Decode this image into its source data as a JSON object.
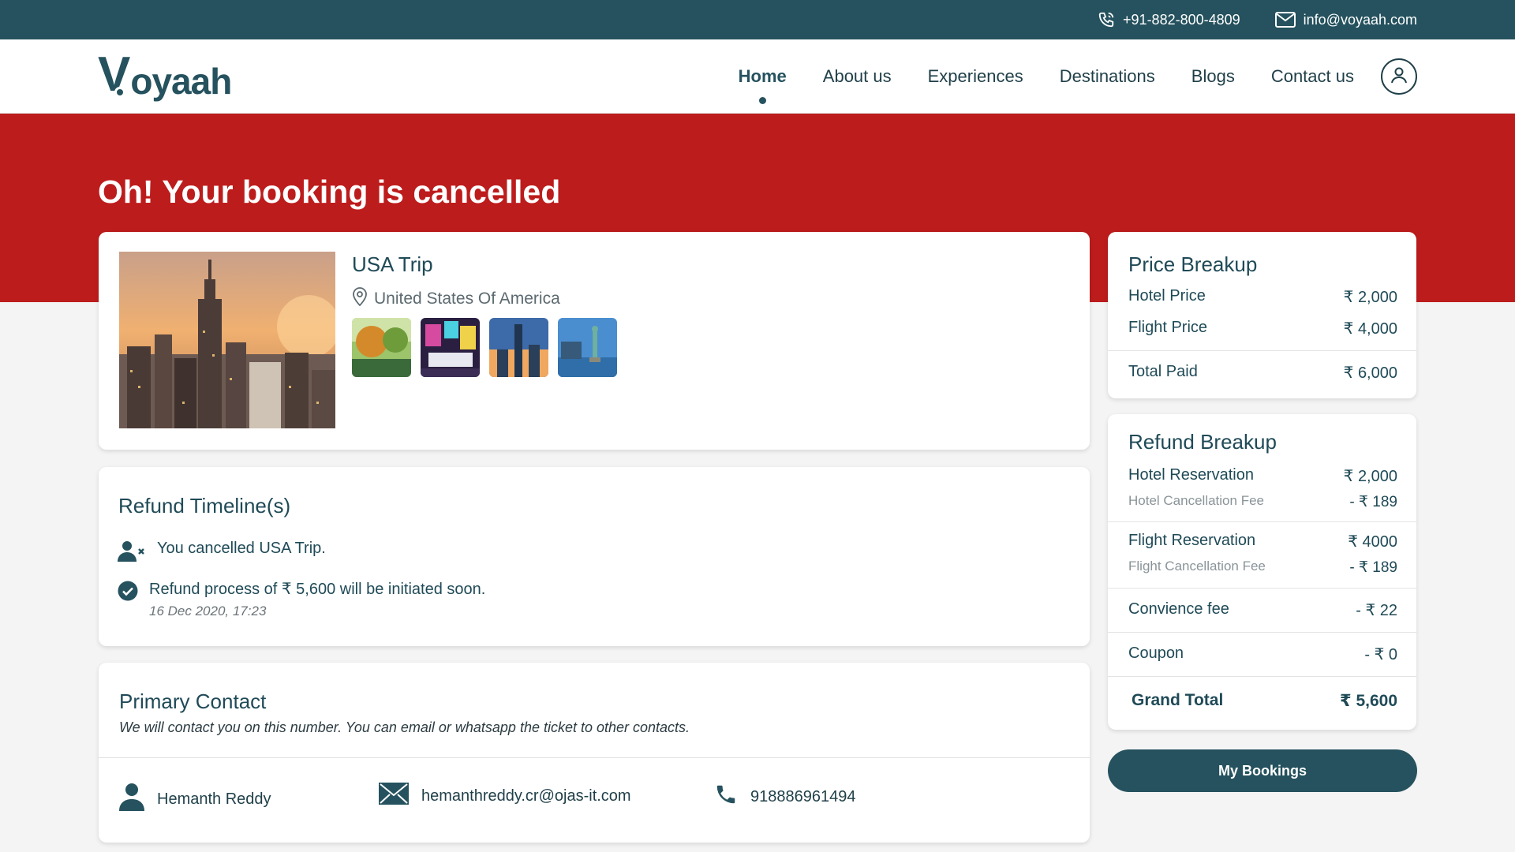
{
  "topbar": {
    "phone": "+91-882-800-4809",
    "email": "info@voyaah.com"
  },
  "brand": {
    "logo_v": "V",
    "logo_rest": "oyaah"
  },
  "nav": {
    "items": [
      {
        "label": "Home",
        "active": true
      },
      {
        "label": "About us"
      },
      {
        "label": "Experiences"
      },
      {
        "label": "Destinations"
      },
      {
        "label": "Blogs"
      },
      {
        "label": "Contact us"
      }
    ],
    "user_icon": "user-icon"
  },
  "banner": {
    "title": "Oh! Your booking is cancelled",
    "color": "#bd1c1c"
  },
  "trip": {
    "title": "USA Trip",
    "location": "United States Of America"
  },
  "timeline": {
    "title": "Refund Timeline(s)",
    "events": [
      {
        "text": "You cancelled USA Trip.",
        "icon": "user-cancel-icon"
      },
      {
        "text": "Refund process of ₹ 5,600 will be initiated soon.",
        "time": "16 Dec 2020, 17:23",
        "icon": "check-circle-icon"
      }
    ]
  },
  "contact": {
    "title": "Primary Contact",
    "subtitle": "We will contact you on this number. You can email or whatsapp the ticket to other contacts.",
    "name": "Hemanth Reddy",
    "email": "hemanthreddy.cr@ojas-it.com",
    "phone": "918886961494"
  },
  "price": {
    "title": "Price Breakup",
    "hotel_label": "Hotel Price",
    "hotel_value": "₹ 2,000",
    "flight_label": "Flight Price",
    "flight_value": "₹ 4,000",
    "total_label": "Total Paid",
    "total_value": "₹ 6,000"
  },
  "refund": {
    "title": "Refund Breakup",
    "hotel_res_label": "Hotel Reservation",
    "hotel_res_value": "₹ 2,000",
    "hotel_fee_label": "Hotel Cancellation Fee",
    "hotel_fee_value": "- ₹ 189",
    "flight_res_label": "Flight Reservation",
    "flight_res_value": "₹ 4000",
    "flight_fee_label": "Flight Cancellation Fee",
    "flight_fee_value": "- ₹ 189",
    "conv_label": "Convience fee",
    "conv_value": "- ₹ 22",
    "coupon_label": "Coupon",
    "coupon_value": "- ₹ 0",
    "grand_label": "Grand Total",
    "grand_value": "₹ 5,600"
  },
  "actions": {
    "my_bookings": "My Bookings"
  },
  "colors": {
    "primary": "#25525e",
    "banner": "#bd1c1c"
  }
}
